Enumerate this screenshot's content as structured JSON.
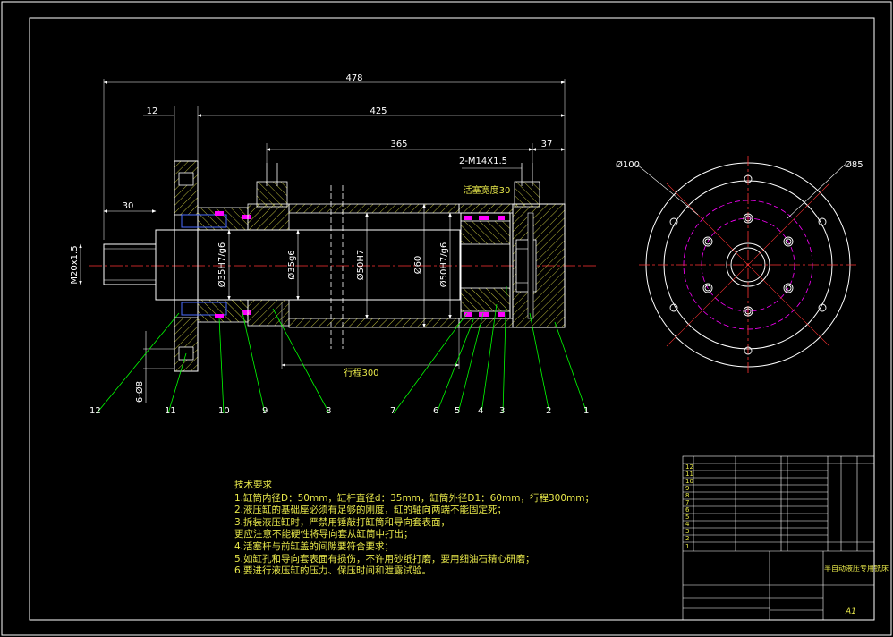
{
  "dimensions": {
    "overall": "478",
    "d12": "12",
    "d425": "425",
    "d365": "365",
    "d37": "37",
    "d30": "30",
    "thread_port": "2-M14X1.5",
    "piston_width": "活塞宽度30",
    "stroke": "行程300",
    "rod_thread": "M20x1.5",
    "d_rod_bore": "Ø35H7/g6",
    "d_rod": "Ø35g6",
    "d_bore": "Ø50H7",
    "d_outer": "Ø60",
    "d_piston": "Ø50H7/g6",
    "holes": "6-Ø8",
    "end_d100": "Ø100",
    "end_d85": "Ø85"
  },
  "part_numbers": [
    "12",
    "11",
    "10",
    "9",
    "8",
    "7",
    "6",
    "5",
    "4",
    "3",
    "2",
    "1"
  ],
  "tech_requirements": {
    "title": "技术要求",
    "lines": [
      "1.缸筒内径D：50mm，缸杆直径d：35mm，缸筒外径D1：60mm，行程300mm；",
      "2.液压缸的基础座必须有足够的刚度，缸的轴向两端不能固定死；",
      "3.拆装液压缸时，严禁用锤敲打缸筒和导向套表面，",
      "更应注意不能硬性将导向套从缸筒中打出；",
      "4.活塞杆与前缸盖的间隙要符合要求；",
      "5.如缸孔和导向套表面有损伤，不许用砂纸打磨，要用细油石精心研磨；",
      "6.要进行液压缸的压力、保压时间和泄露试验。"
    ]
  },
  "title_block": {
    "project": "半自动液压专用铣床",
    "sheet": "A1",
    "rows": [
      "12",
      "11",
      "10",
      "9",
      "8",
      "7",
      "6",
      "5",
      "4",
      "3",
      "2",
      "1"
    ]
  },
  "colors": {
    "frame": "#ffffff",
    "part": "#ffffff",
    "dimension": "#ffffff",
    "center": "#ff3333",
    "leader": "#00ff00",
    "hatch": "#e8e84a",
    "seal": "#ff00ff",
    "text": "#e8e84a"
  }
}
